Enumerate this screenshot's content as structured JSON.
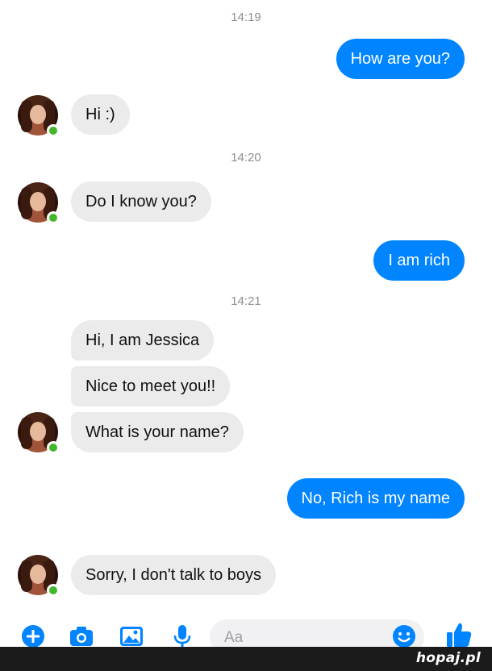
{
  "timestamps": [
    "14:19",
    "14:20",
    "14:21"
  ],
  "messages": {
    "m1": "How are you?",
    "m2": "Hi :)",
    "m3": "Do I know you?",
    "m4": "I am rich",
    "m5": "Hi, I am Jessica",
    "m6": "Nice to meet you!!",
    "m7": "What is your name?",
    "m8": "No, Rich is my name",
    "m9": "Sorry, I don't talk to boys"
  },
  "composer": {
    "placeholder": "Aa",
    "icons": [
      "plus-icon",
      "camera-icon",
      "image-icon",
      "microphone-icon",
      "emoji-icon",
      "thumbs-up-icon"
    ]
  },
  "colors": {
    "accent": "#0084ff",
    "incoming": "#ebebeb",
    "online": "#42b72a"
  },
  "watermark": "hopaj.pl"
}
